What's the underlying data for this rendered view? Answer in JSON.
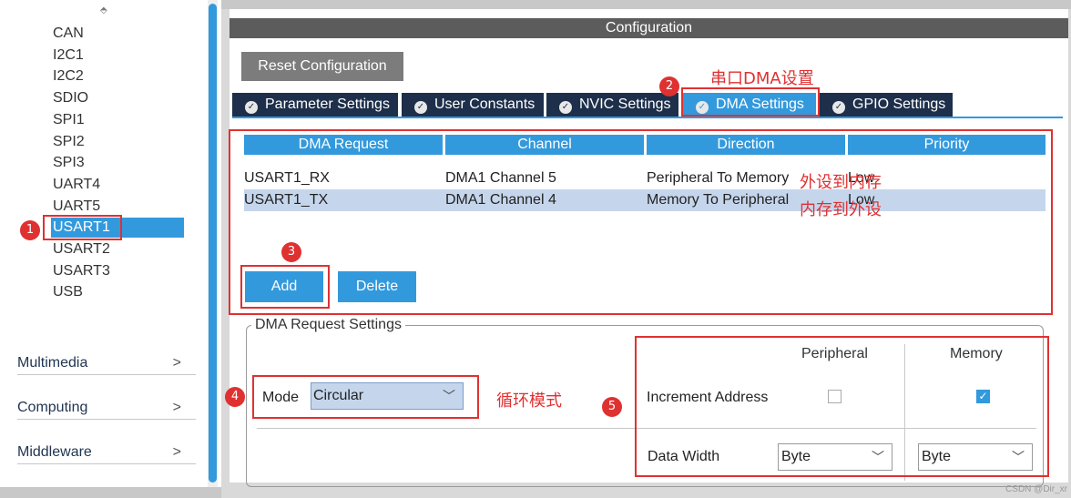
{
  "sidebar": {
    "peripherals": [
      "CAN",
      "I2C1",
      "I2C2",
      "SDIO",
      "SPI1",
      "SPI2",
      "SPI3",
      "UART4",
      "UART5",
      "USART1",
      "USART2",
      "USART3",
      "USB"
    ],
    "selected_index": 9,
    "categories": [
      "Multimedia",
      "Computing",
      "Middleware"
    ]
  },
  "config": {
    "title": "Configuration",
    "reset_label": "Reset Configuration",
    "tabs": [
      "Parameter Settings",
      "User Constants",
      "NVIC Settings",
      "DMA Settings",
      "GPIO Settings"
    ],
    "active_tab": 3
  },
  "dma_table": {
    "headers": [
      "DMA Request",
      "Channel",
      "Direction",
      "Priority"
    ],
    "rows": [
      {
        "request": "USART1_RX",
        "channel": "DMA1 Channel 5",
        "direction": "Peripheral To Memory",
        "priority": "Low"
      },
      {
        "request": "USART1_TX",
        "channel": "DMA1 Channel 4",
        "direction": "Memory To Peripheral",
        "priority": "Low"
      }
    ],
    "selected_row": 1,
    "add_label": "Add",
    "delete_label": "Delete"
  },
  "request_settings": {
    "legend": "DMA Request Settings",
    "mode_label": "Mode",
    "mode_value": "Circular",
    "col_peripheral": "Peripheral",
    "col_memory": "Memory",
    "increment_label": "Increment Address",
    "increment_peripheral": false,
    "increment_memory": true,
    "data_width_label": "Data Width",
    "data_width_peripheral": "Byte",
    "data_width_memory": "Byte"
  },
  "annotations": {
    "badges": [
      "1",
      "2",
      "3",
      "4",
      "5"
    ],
    "dma_settings_note": "串口DMA设置",
    "rx_note": "外设到内存",
    "tx_note": "内存到外设",
    "mode_note": "循环模式"
  },
  "watermark": "CSDN @Dir_xr",
  "colors": {
    "accent": "#3399dd",
    "tab_dark": "#1d2f4a",
    "annotation": "#e03131",
    "selected_row": "#c5d6ec"
  }
}
